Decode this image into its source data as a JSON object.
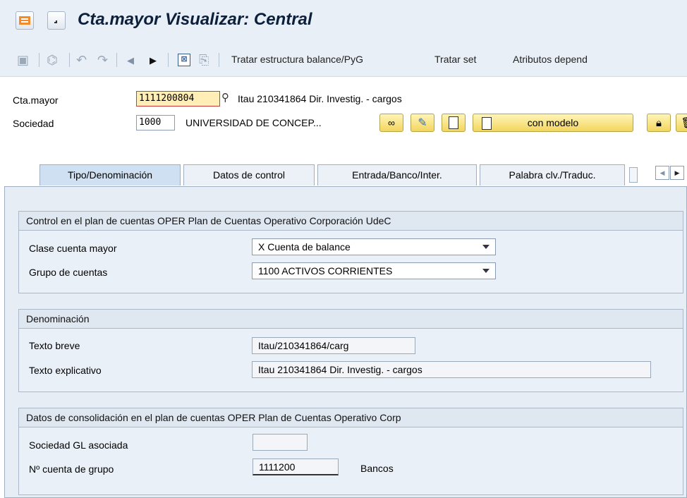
{
  "window": {
    "title": "Cta.mayor Visualizar: Central"
  },
  "toolbar": {
    "items": [
      "Tratar estructura balance/PyG",
      "Tratar set",
      "Atributos depend"
    ]
  },
  "header": {
    "gl_label": "Cta.mayor",
    "gl_value": "1111200804",
    "gl_desc": "Itau 210341864 Dir. Investig. - cargos",
    "company_label": "Sociedad",
    "company_value": "1000",
    "company_desc": "UNIVERSIDAD DE CONCEP...",
    "model_button": "con modelo"
  },
  "tabs": [
    {
      "label": "Tipo/Denominación",
      "active": true
    },
    {
      "label": "Datos de control",
      "active": false
    },
    {
      "label": "Entrada/Banco/Inter.",
      "active": false
    },
    {
      "label": "Palabra clv./Traduc.",
      "active": false
    }
  ],
  "group1": {
    "title": "Control en el plan de cuentas OPER Plan de Cuentas Operativo Corporación UdeC",
    "rows": [
      {
        "label": "Clase cuenta mayor",
        "value": "X Cuenta de balance"
      },
      {
        "label": "Grupo de cuentas",
        "value": "1100 ACTIVOS CORRIENTES"
      }
    ]
  },
  "group2": {
    "title": "Denominación",
    "short_label": "Texto breve",
    "short_value": "Itau/210341864/carg",
    "long_label": "Texto explicativo",
    "long_value": "Itau 210341864 Dir. Investig. - cargos"
  },
  "group3": {
    "title": "Datos de consolidación en el plan de cuentas OPER Plan de Cuentas Operativo Corp",
    "assoc_label": "Sociedad GL asociada",
    "assoc_value": "",
    "group_acct_label": "Nº cuenta de grupo",
    "group_acct_value": "1111200",
    "group_acct_desc": "Bancos"
  },
  "colors": {
    "accent": "#f3d65e",
    "panel": "#e6edf5",
    "title_bg": "#e9eff7"
  }
}
